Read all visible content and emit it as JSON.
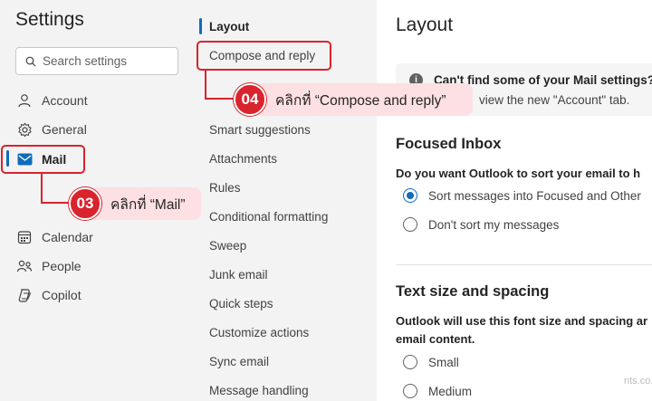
{
  "left": {
    "title": "Settings",
    "search_placeholder": "Search settings",
    "items": [
      {
        "label": "Account",
        "icon": "person-icon"
      },
      {
        "label": "General",
        "icon": "gear-icon"
      },
      {
        "label": "Mail",
        "icon": "mail-icon",
        "active": true
      },
      {
        "label": "Calendar",
        "icon": "calendar-icon"
      },
      {
        "label": "People",
        "icon": "people-icon"
      },
      {
        "label": "Copilot",
        "icon": "copilot-icon"
      }
    ]
  },
  "middle": {
    "items": [
      "Layout",
      "Compose and reply",
      "Smart suggestions",
      "Attachments",
      "Rules",
      "Conditional formatting",
      "Sweep",
      "Junk email",
      "Quick steps",
      "Customize actions",
      "Sync email",
      "Message handling"
    ],
    "active_index": 0
  },
  "content": {
    "title": "Layout",
    "info_title": "Can't find some of your Mail settings?",
    "info_text": "view the new \"Account\" tab.",
    "focused": {
      "title": "Focused Inbox",
      "question": "Do you want Outlook to sort your email to h",
      "options": [
        "Sort messages into Focused and Other",
        "Don't sort my messages"
      ],
      "selected": 0
    },
    "text_size": {
      "title": "Text size and spacing",
      "question_line1": "Outlook will use this font size and spacing ar",
      "question_line2": "email content.",
      "options": [
        "Small",
        "Medium"
      ]
    },
    "watermark": "nts.co.th"
  },
  "callouts": {
    "c03": {
      "num": "03",
      "text": "คลิกที่ “Mail”"
    },
    "c04": {
      "num": "04",
      "text": "คลิกที่ “Compose and reply”"
    }
  },
  "colors": {
    "accent": "#0f6cbd",
    "annotation": "#d9232d",
    "callout_bg": "#fde0e3"
  }
}
